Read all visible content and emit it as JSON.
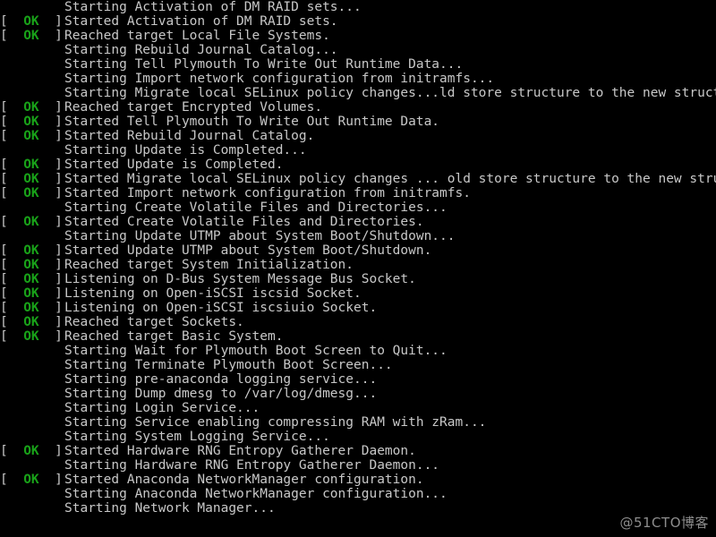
{
  "console": {
    "background_color": "#000000",
    "text_color": "#c8c8c8",
    "ok_color": "#19a319",
    "status_ok_prefix": "[  OK  ] ",
    "status_blank_prefix": "        ",
    "ok_bracket_open": "[",
    "ok_bracket_close": "]",
    "ok_label": "OK",
    "lines": [
      {
        "status": "none",
        "text": "Starting Activation of DM RAID sets..."
      },
      {
        "status": "ok",
        "text": "Started Activation of DM RAID sets."
      },
      {
        "status": "ok",
        "text": "Reached target Local File Systems."
      },
      {
        "status": "none",
        "text": "Starting Rebuild Journal Catalog..."
      },
      {
        "status": "none",
        "text": "Starting Tell Plymouth To Write Out Runtime Data..."
      },
      {
        "status": "none",
        "text": "Starting Import network configuration from initramfs..."
      },
      {
        "status": "none",
        "text": "Starting Migrate local SELinux policy changes...ld store structure to the new structure..."
      },
      {
        "status": "ok",
        "text": "Reached target Encrypted Volumes."
      },
      {
        "status": "ok",
        "text": "Started Tell Plymouth To Write Out Runtime Data."
      },
      {
        "status": "ok",
        "text": "Started Rebuild Journal Catalog."
      },
      {
        "status": "none",
        "text": "Starting Update is Completed..."
      },
      {
        "status": "ok",
        "text": "Started Update is Completed."
      },
      {
        "status": "ok",
        "text": "Started Migrate local SELinux policy changes ... old store structure to the new structure."
      },
      {
        "status": "ok",
        "text": "Started Import network configuration from initramfs."
      },
      {
        "status": "none",
        "text": "Starting Create Volatile Files and Directories..."
      },
      {
        "status": "ok",
        "text": "Started Create Volatile Files and Directories."
      },
      {
        "status": "none",
        "text": "Starting Update UTMP about System Boot/Shutdown..."
      },
      {
        "status": "ok",
        "text": "Started Update UTMP about System Boot/Shutdown."
      },
      {
        "status": "ok",
        "text": "Reached target System Initialization."
      },
      {
        "status": "ok",
        "text": "Listening on D-Bus System Message Bus Socket."
      },
      {
        "status": "ok",
        "text": "Listening on Open-iSCSI iscsid Socket."
      },
      {
        "status": "ok",
        "text": "Listening on Open-iSCSI iscsiuio Socket."
      },
      {
        "status": "ok",
        "text": "Reached target Sockets."
      },
      {
        "status": "ok",
        "text": "Reached target Basic System."
      },
      {
        "status": "none",
        "text": "Starting Wait for Plymouth Boot Screen to Quit..."
      },
      {
        "status": "none",
        "text": "Starting Terminate Plymouth Boot Screen..."
      },
      {
        "status": "none",
        "text": "Starting pre-anaconda logging service..."
      },
      {
        "status": "none",
        "text": "Starting Dump dmesg to /var/log/dmesg..."
      },
      {
        "status": "none",
        "text": "Starting Login Service..."
      },
      {
        "status": "none",
        "text": "Starting Service enabling compressing RAM with zRam..."
      },
      {
        "status": "none",
        "text": "Starting System Logging Service..."
      },
      {
        "status": "ok",
        "text": "Started Hardware RNG Entropy Gatherer Daemon."
      },
      {
        "status": "none",
        "text": "Starting Hardware RNG Entropy Gatherer Daemon..."
      },
      {
        "status": "ok",
        "text": "Started Anaconda NetworkManager configuration."
      },
      {
        "status": "none",
        "text": "Starting Anaconda NetworkManager configuration..."
      },
      {
        "status": "none",
        "text": "Starting Network Manager..."
      }
    ]
  },
  "watermark": {
    "text": "@51CTO博客"
  }
}
